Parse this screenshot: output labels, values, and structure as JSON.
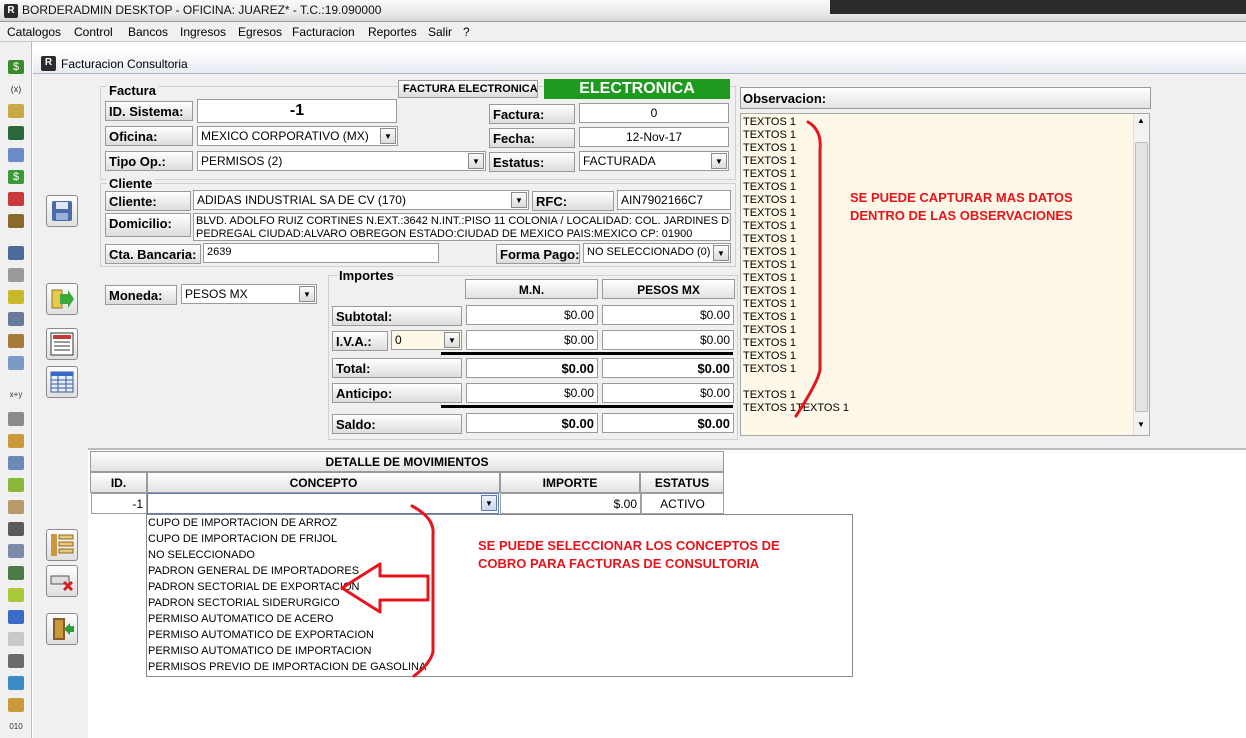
{
  "window": {
    "title": "BORDERADMIN DESKTOP - OFICINA: JUAREZ* -   T.C.:19.090000"
  },
  "menu": [
    "Catalogos",
    "Control",
    "Bancos",
    "Ingresos",
    "Egresos",
    "Facturacion",
    "Reportes",
    "Salir",
    "?"
  ],
  "child_window": {
    "title": "Facturacion Consultoria"
  },
  "factura": {
    "group_label": "Factura",
    "btn_electronica": "FACTURA ELECTRONICA",
    "badge": "ELECTRONICA",
    "id_sistema_label": "ID. Sistema:",
    "id_sistema": "-1",
    "oficina_label": "Oficina:",
    "oficina": "MEXICO CORPORATIVO (MX)",
    "tipo_op_label": "Tipo Op.:",
    "tipo_op": "PERMISOS (2)",
    "factura_label": "Factura:",
    "factura": "0",
    "fecha_label": "Fecha:",
    "fecha": "12-Nov-17",
    "estatus_label": "Estatus:",
    "estatus": "FACTURADA"
  },
  "cliente": {
    "group_label": "Cliente",
    "cliente_label": "Cliente:",
    "cliente": "ADIDAS INDUSTRIAL SA DE CV (170)",
    "rfc_label": "RFC:",
    "rfc": "AIN7902166C7",
    "domicilio_label": "Domicilio:",
    "domicilio_line1": "BLVD. ADOLFO RUIZ CORTINES N.EXT.:3642 N.INT.:PISO 11 COLONIA / LOCALIDAD: COL. JARDINES DEL",
    "domicilio_line2": "PEDREGAL CIUDAD:ALVARO OBREGON ESTADO:CIUDAD DE MEXICO PAIS:MEXICO CP: 01900",
    "cta_label": "Cta. Bancaria:",
    "cta": "2639",
    "forma_pago_label": "Forma Pago:",
    "forma_pago": "NO SELECCIONADO (0)"
  },
  "moneda": {
    "label": "Moneda:",
    "value": "PESOS MX"
  },
  "importes": {
    "group_label": "Importes",
    "col_mn": "M.N.",
    "col_pesos": "PESOS MX",
    "subtotal_label": "Subtotal:",
    "subtotal_mn": "$0.00",
    "subtotal_pesos": "$0.00",
    "iva_label": "I.V.A.:",
    "iva_rate": "0",
    "iva_mn": "$0.00",
    "iva_pesos": "$0.00",
    "total_label": "Total:",
    "total_mn": "$0.00",
    "total_pesos": "$0.00",
    "anticipo_label": "Anticipo:",
    "anticipo_mn": "$0.00",
    "anticipo_pesos": "$0.00",
    "saldo_label": "Saldo:",
    "saldo_mn": "$0.00",
    "saldo_pesos": "$0.00"
  },
  "observacion": {
    "header": "Observacion:",
    "lines": [
      "TEXTOS 1",
      "TEXTOS 1",
      "TEXTOS 1",
      "TEXTOS 1",
      "TEXTOS 1",
      "TEXTOS 1",
      "TEXTOS 1",
      "TEXTOS 1",
      "TEXTOS 1",
      "TEXTOS 1",
      "TEXTOS 1",
      "TEXTOS 1",
      "TEXTOS 1",
      "TEXTOS 1",
      "TEXTOS 1",
      "TEXTOS 1",
      "TEXTOS 1",
      "TEXTOS 1",
      "TEXTOS 1",
      "TEXTOS 1",
      "",
      "TEXTOS 1",
      "TEXTOS 1TEXTOS 1"
    ]
  },
  "detalle": {
    "title": "DETALLE DE MOVIMIENTOS",
    "col_id": "ID.",
    "col_concepto": "CONCEPTO",
    "col_importe": "IMPORTE",
    "col_estatus": "ESTATUS",
    "row_id": "-1",
    "row_concepto": "",
    "row_importe": "$.00",
    "row_estatus": "ACTIVO",
    "options": [
      "CUPO DE IMPORTACION DE ARROZ",
      "CUPO DE IMPORTACION DE FRIJOL",
      "NO SELECCIONADO",
      "PADRON GENERAL DE IMPORTADORES",
      "PADRON SECTORIAL DE EXPORTACION",
      "PADRON SECTORIAL SIDERURGICO",
      "PERMISO AUTOMATICO DE ACERO",
      "PERMISO AUTOMATICO DE EXPORTACION",
      "PERMISO AUTOMATICO DE IMPORTACION",
      "PERMISOS PREVIO DE IMPORTACION DE GASOLINA"
    ]
  },
  "annotations": {
    "obs_line1": "SE PUEDE CAPTURAR MAS DATOS",
    "obs_line2": "DENTRO DE LAS OBSERVACIONES",
    "concept_line1": "SE PUEDE SELECCIONAR LOS CONCEPTOS DE",
    "concept_line2": "COBRO PARA FACTURAS DE CONSULTORIA"
  },
  "colors": {
    "badge_green": "#1e9b1e",
    "annotation_red": "#e8141c",
    "obs_bg": "#fdf8e8"
  },
  "icons": [
    "app-r-icon",
    "money-bag-icon",
    "formula-icon",
    "floppy-save-icon",
    "export-arrow-icon",
    "report-icon",
    "grid-table-icon",
    "row-list-icon",
    "row-delete-icon",
    "exit-door-icon"
  ]
}
